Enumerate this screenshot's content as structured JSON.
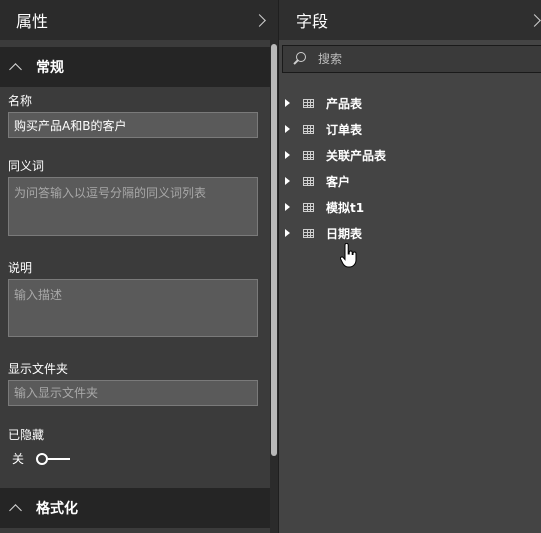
{
  "properties": {
    "title": "属性",
    "general_section": "常规",
    "name_label": "名称",
    "name_value": "购买产品A和B的客户",
    "synonyms_label": "同义词",
    "synonyms_placeholder": "为问答输入以逗号分隔的同义词列表",
    "description_label": "说明",
    "description_placeholder": "输入描述",
    "display_folder_label": "显示文件夹",
    "display_folder_placeholder": "输入显示文件夹",
    "hidden_label": "已隐藏",
    "hidden_toggle_state": "关",
    "format_section": "格式化"
  },
  "fields": {
    "title": "字段",
    "search_placeholder": "搜索",
    "tables": [
      {
        "label": "产品表"
      },
      {
        "label": "订单表"
      },
      {
        "label": "关联产品表"
      },
      {
        "label": "客户"
      },
      {
        "label": "模拟t1"
      },
      {
        "label": "日期表"
      }
    ]
  },
  "icons": {
    "collapse": "chevron-right-icon",
    "section": "chevron-up-icon",
    "search": "magnifier-icon",
    "table": "table-grid-icon",
    "expand": "caret-right-icon",
    "cursor": "hand-pointer-icon"
  },
  "colors": {
    "pane_bg": "#3b3b3b",
    "header_bg": "#2b2b2b",
    "section_bg": "#252525",
    "fields_bg": "#444444",
    "input_bg": "#5a5a5a"
  }
}
